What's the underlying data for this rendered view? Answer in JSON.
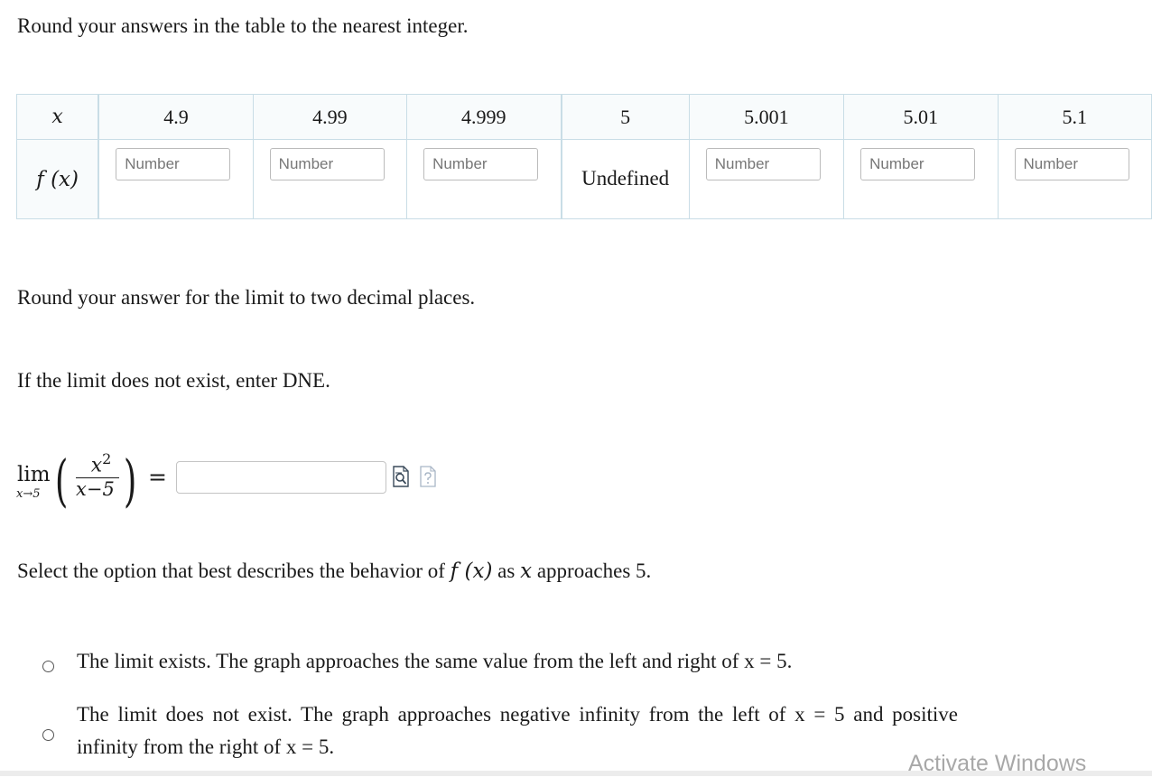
{
  "instructions": {
    "table_rounding": "Round your answers in the table to the nearest integer.",
    "limit_rounding": "Round your answer for the limit to two decimal places.",
    "dne_note": "If the limit does not exist, enter DNE.",
    "select_prompt_before": "Select the option that best describes the behavior of",
    "select_prompt_func": "f (x)",
    "select_prompt_as": "as",
    "select_prompt_var": "x",
    "select_prompt_after": "approaches 5."
  },
  "table": {
    "x_label": "x",
    "fx_label": "f (x)",
    "x_values": [
      "4.9",
      "4.99",
      "4.999",
      "5",
      "5.001",
      "5.01",
      "5.1"
    ],
    "input_placeholder": "Number",
    "inputs": [
      {
        "value": "",
        "placeholder": "Number"
      },
      {
        "value": "",
        "placeholder": "Number"
      },
      {
        "value": "",
        "placeholder": "Number"
      },
      {
        "value": "",
        "placeholder": "Number"
      },
      {
        "value": "",
        "placeholder": "Number"
      },
      {
        "value": "",
        "placeholder": "Number"
      }
    ],
    "undefined_text": "Undefined"
  },
  "limit": {
    "lim": "lim",
    "sub": "x→5",
    "numerator": "x",
    "exponent": "2",
    "denominator": "x−5",
    "equals": "=",
    "answer_value": "",
    "left_paren": "(",
    "right_paren": ")",
    "preview_icon": "preview-doc-icon",
    "help_icon": "help-doc-icon"
  },
  "options": [
    {
      "text": "The limit exists. The graph approaches the same value from the left and right of x = 5.",
      "selected": false
    },
    {
      "text": "The limit does not exist. The graph approaches negative infinity from the left of x = 5 and positive infinity from the right of x = 5.",
      "selected": false
    }
  ],
  "watermark": "Activate Windows"
}
